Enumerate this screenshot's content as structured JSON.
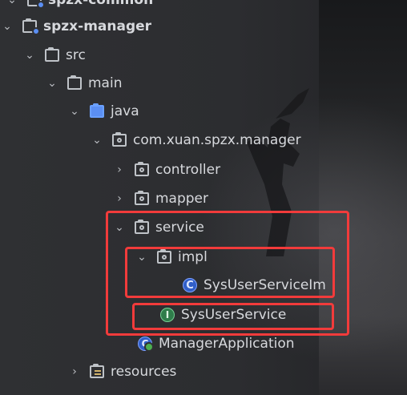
{
  "tree": {
    "items": [
      {
        "label": "spzx-common",
        "icon": "module-folder-icon"
      },
      {
        "label": "spzx-manager",
        "icon": "module-folder-icon"
      },
      {
        "label": "src",
        "icon": "folder-icon"
      },
      {
        "label": "main",
        "icon": "folder-icon"
      },
      {
        "label": "java",
        "icon": "source-folder-icon"
      },
      {
        "label": "com.xuan.spzx.manager",
        "icon": "package-icon"
      },
      {
        "label": "controller",
        "icon": "package-icon"
      },
      {
        "label": "mapper",
        "icon": "package-icon"
      },
      {
        "label": "service",
        "icon": "package-icon"
      },
      {
        "label": "impl",
        "icon": "package-icon"
      },
      {
        "label": "SysUserServiceIm",
        "icon": "class-icon"
      },
      {
        "label": "SysUserService",
        "icon": "interface-icon"
      },
      {
        "label": "ManagerApplication",
        "icon": "application-class-icon"
      },
      {
        "label": "resources",
        "icon": "resources-folder-icon"
      }
    ]
  },
  "icons": {
    "class_letter": "C",
    "interface_letter": "I",
    "app_letter": "C"
  },
  "colors": {
    "highlight_red": "#f23b3b",
    "class_blue": "#315fc8",
    "interface_green": "#2f7d4b"
  }
}
